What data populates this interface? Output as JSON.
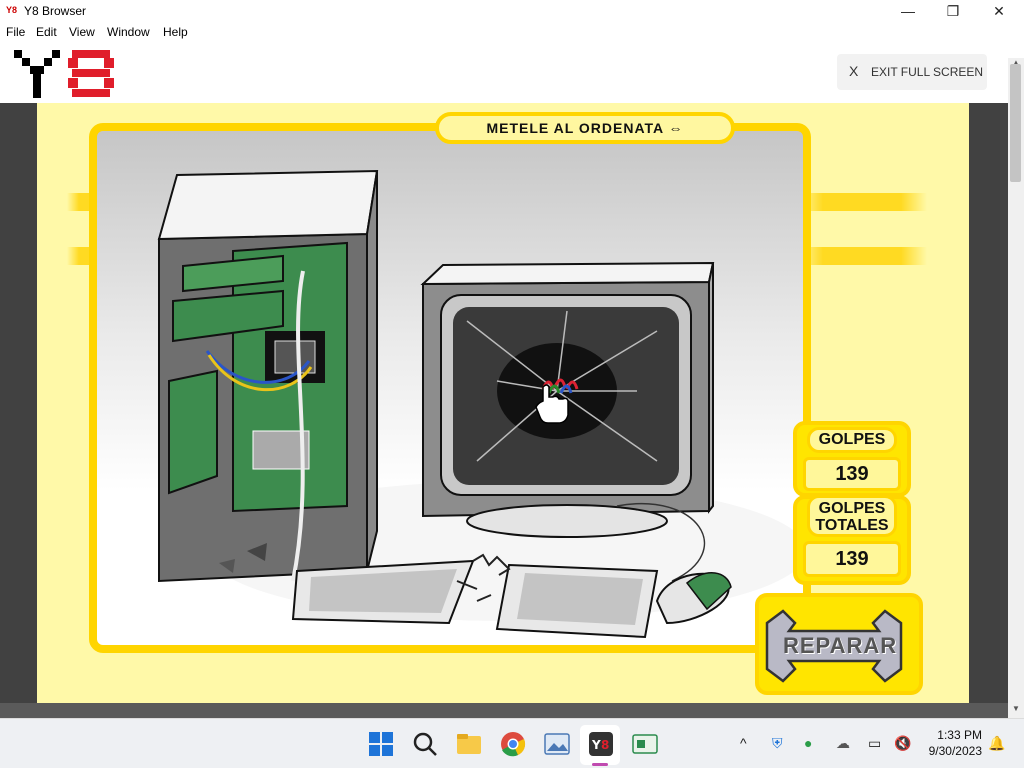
{
  "window": {
    "title": "Y8 Browser",
    "icon": "y8-app-icon",
    "minimize": "—",
    "maximize": "❐",
    "close": "✕"
  },
  "menu": [
    "File",
    "Edit",
    "View",
    "Window",
    "Help"
  ],
  "site": {
    "logo": "Y8",
    "exit_x": "X",
    "exit_label": "EXIT FULL SCREEN"
  },
  "game": {
    "title": "METELE AL ORDENATA",
    "golpes_label": "GOLPES",
    "golpes_value": "139",
    "totales_label_1": "GOLPES",
    "totales_label_2": "TOTALES",
    "totales_value": "139",
    "repair_label": "REPARAR"
  },
  "taskbar": {
    "time": "1:33 PM",
    "date": "9/30/2023",
    "apps": [
      "start-icon",
      "search-icon",
      "file-explorer-icon",
      "chrome-icon",
      "photos-icon",
      "y8-browser-icon",
      "app-icon"
    ],
    "tray": [
      "chevron-up-icon",
      "shield-icon",
      "utorrent-icon",
      "onedrive-icon",
      "monitor-icon",
      "speaker-muted-icon",
      "bell-icon"
    ]
  },
  "colors": {
    "accent_yellow": "#ffd500",
    "panel_yellow": "#ffe500",
    "background_yellow": "#fff9a8",
    "dark_surround": "#414141",
    "logo_red": "#e01e2b"
  }
}
